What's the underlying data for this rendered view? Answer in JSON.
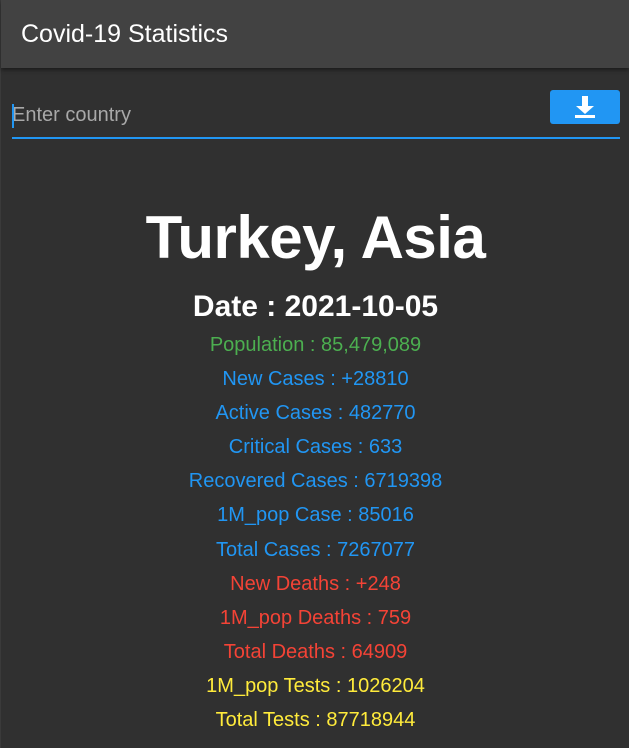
{
  "appbar": {
    "title": "Covid-19 Statistics"
  },
  "search": {
    "placeholder": "Enter country",
    "value": "",
    "button_icon": "download-icon"
  },
  "colors": {
    "accent": "#2196f3",
    "population": "#4caf50",
    "cases": "#2196f3",
    "deaths": "#f44336",
    "tests": "#ffeb3b"
  },
  "result": {
    "location": "Turkey, Asia",
    "date": "Date : 2021-10-05",
    "stats": {
      "population": "Population : 85,479,089",
      "new_cases": "New Cases : +28810",
      "active_cases": "Active Cases : 482770",
      "critical_cases": "Critical Cases : 633",
      "recovered_cases": "Recovered Cases : 6719398",
      "pop_case": "1M_pop Case : 85016",
      "total_cases": "Total Cases : 7267077",
      "new_deaths": "New Deaths : +248",
      "pop_deaths": "1M_pop Deaths : 759",
      "total_deaths": "Total Deaths : 64909",
      "pop_tests": "1M_pop Tests : 1026204",
      "total_tests": "Total Tests : 87718944"
    }
  }
}
